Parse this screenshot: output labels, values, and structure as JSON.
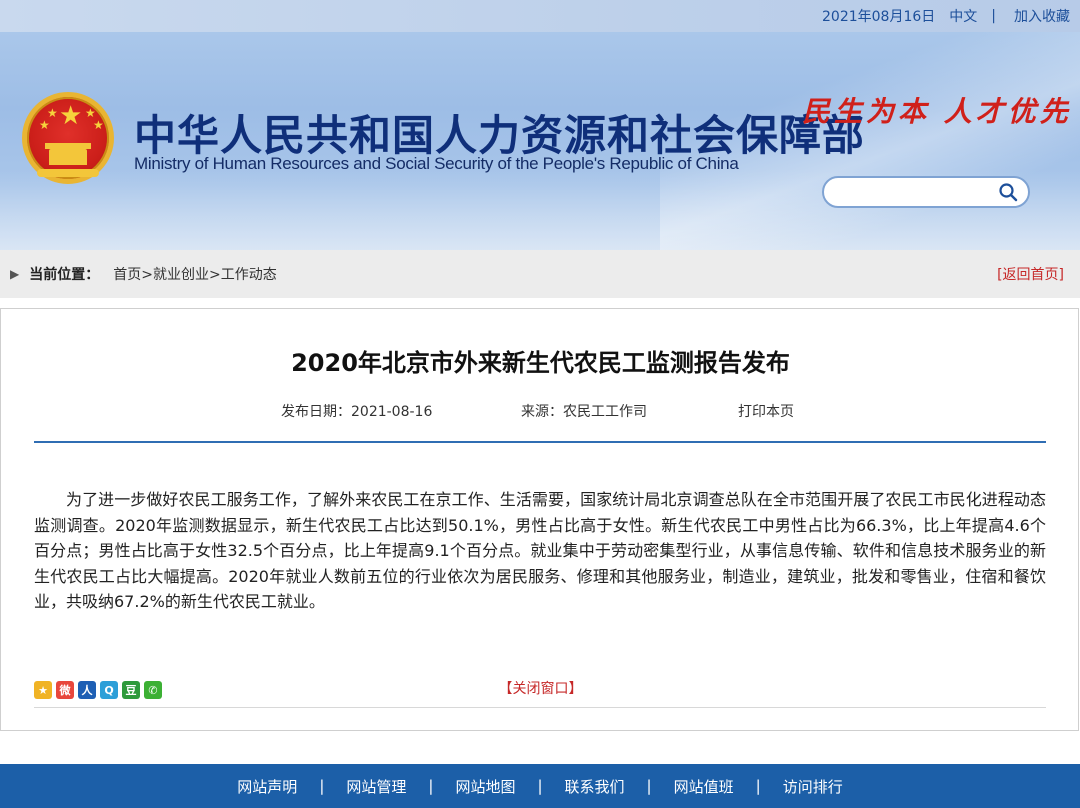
{
  "topbar": {
    "date": "2021年08月16日",
    "lang": "中文",
    "separator": "|",
    "favorite": "加入收藏"
  },
  "header": {
    "title_cn": "中华人民共和国人力资源和社会保障部",
    "title_en": "Ministry of Human Resources and Social Security of the People's Republic of China",
    "slogan": "民生为本 人才优先",
    "search_placeholder": ""
  },
  "breadcrumb": {
    "label": "当前位置：",
    "path": "首页>就业创业>工作动态",
    "back": "[返回首页]"
  },
  "article": {
    "title": "2020年北京市外来新生代农民工监测报告发布",
    "date": "发布日期：2021-08-16",
    "source": "来源：农民工工作司",
    "print": "打印本页",
    "body": "为了进一步做好农民工服务工作，了解外来农民工在京工作、生活需要，国家统计局北京调查总队在全市范围开展了农民工市民化进程动态监测调查。2020年监测数据显示，新生代农民工占比达到50.1%，男性占比高于女性。新生代农民工中男性占比为66.3%，比上年提高4.6个百分点；男性占比高于女性32.5个百分点，比上年提高9.1个百分点。就业集中于劳动密集型行业，从事信息传输、软件和信息技术服务业的新生代农民工占比大幅提高。2020年就业人数前五位的行业依次为居民服务、修理和其他服务业，制造业，建筑业，批发和零售业，住宿和餐饮业，共吸纳67.2%的新生代农民工就业。",
    "close": "【关闭窗口】",
    "share_icons": [
      {
        "name": "qzone-icon",
        "glyph": "★",
        "color": "#f0b325"
      },
      {
        "name": "weibo-icon",
        "glyph": "微",
        "color": "#e8473c"
      },
      {
        "name": "people-icon",
        "glyph": "人",
        "color": "#1e5fb4"
      },
      {
        "name": "tqq-icon",
        "glyph": "Q",
        "color": "#2d9fd8"
      },
      {
        "name": "douban-icon",
        "glyph": "豆",
        "color": "#2e9a3b"
      },
      {
        "name": "wechat-icon",
        "glyph": "✆",
        "color": "#3cb034"
      }
    ]
  },
  "footer": {
    "items": [
      "网站声明",
      "网站管理",
      "网站地图",
      "联系我们",
      "网站值班",
      "访问排行"
    ],
    "separator": "|"
  },
  "colors": {
    "brand_blue": "#1c5fa8",
    "link_red": "#c62828",
    "title_navy": "#0f2f7a"
  }
}
